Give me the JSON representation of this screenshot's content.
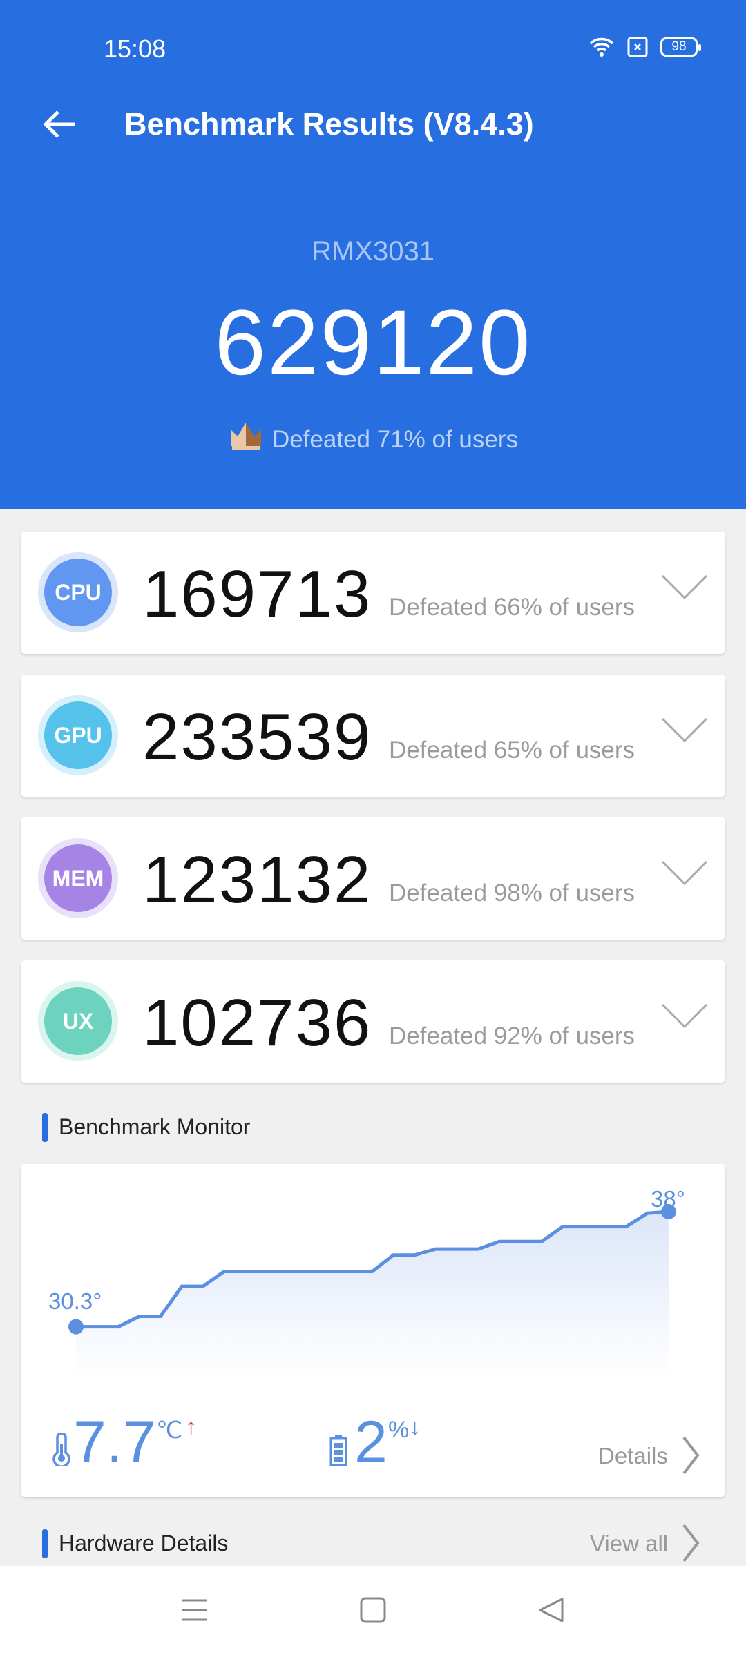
{
  "status_bar": {
    "time": "15:08",
    "battery": "98",
    "icons": [
      "wifi-icon",
      "sim-x-icon",
      "battery-icon"
    ]
  },
  "header": {
    "title": "Benchmark Results (V8.4.3)",
    "model": "RMX3031",
    "total_score": "629120",
    "defeated": "Defeated 71% of users"
  },
  "colors": {
    "brand": "#276ee0",
    "cpu": "#6297f1",
    "gpu": "#55c2ec",
    "mem": "#a684e6",
    "ux": "#6dd3bf"
  },
  "scores": [
    {
      "label": "CPU",
      "score": "169713",
      "defeated": "Defeated 66% of users"
    },
    {
      "label": "GPU",
      "score": "233539",
      "defeated": "Defeated 65% of users"
    },
    {
      "label": "MEM",
      "score": "123132",
      "defeated": "Defeated 98% of users"
    },
    {
      "label": "UX",
      "score": "102736",
      "defeated": "Defeated 92% of users"
    }
  ],
  "monitor": {
    "title": "Benchmark Monitor",
    "start_label": "30.3°",
    "end_label": "38°",
    "temp_rise": "7.7",
    "temp_unit": "℃",
    "temp_arrow": "↑",
    "battery_drop": "2",
    "battery_unit": "%",
    "battery_arrow": "↓",
    "details": "Details"
  },
  "chart_data": {
    "type": "area",
    "ylabel": "",
    "values": [
      30.3,
      30.3,
      30.3,
      31.0,
      31.0,
      33.0,
      33.0,
      34.0,
      34.0,
      34.0,
      34.0,
      34.0,
      34.0,
      34.0,
      34.0,
      35.1,
      35.1,
      35.5,
      35.5,
      35.5,
      36.0,
      36.0,
      36.0,
      37.0,
      37.0,
      37.0,
      37.0,
      37.9,
      38.0
    ],
    "ylim": [
      27,
      38
    ],
    "grid": false
  },
  "hardware": {
    "title": "Hardware Details",
    "view_all": "View all"
  },
  "nav": [
    "menu-icon",
    "home-icon",
    "back-icon"
  ]
}
